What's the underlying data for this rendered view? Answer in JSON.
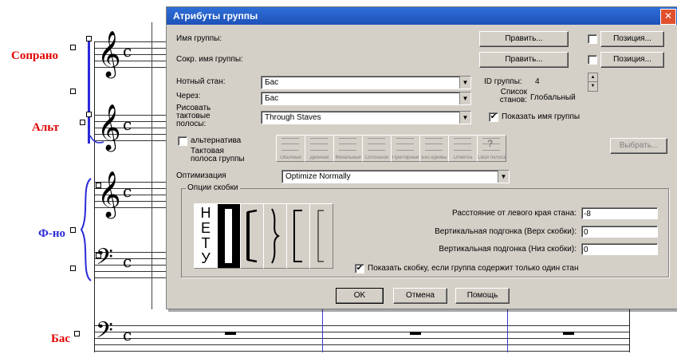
{
  "score": {
    "parts": [
      {
        "name": "Сопрано",
        "color": "#e00000"
      },
      {
        "name": "Альт",
        "color": "#e00000"
      },
      {
        "name": "Ф-но",
        "color": "#2a2ad8"
      },
      {
        "name": "Бас",
        "color": "#e00000"
      }
    ],
    "time_signature": "c"
  },
  "dialog": {
    "title": "Атрибуты группы",
    "group_name_label": "Имя группы:",
    "short_name_label": "Сокр. имя группы:",
    "edit_button": "Править...",
    "edit_button_2": "Править...",
    "position_button": "Позиция...",
    "position_button_2": "Позиция...",
    "staff_label": "Нотный стан:",
    "staff_value": "Бас",
    "through_label": "Через:",
    "through_value": "Бас",
    "draw_barlines_label_1": "Рисовать",
    "draw_barlines_label_2": "тактовые",
    "draw_barlines_label_3": "полосы:",
    "draw_barlines_value": "Through Staves",
    "group_id_label": "ID группы:",
    "group_id_value": "4",
    "staff_list_label_1": "Список",
    "staff_list_label_2": "станов:",
    "staff_list_value": "Глобальный",
    "show_group_name_label": "Показать имя группы",
    "alternative_label": "альтернатива",
    "barline_label_1": "Тактовая",
    "barline_label_2": "полоса группы",
    "barline_tools": [
      "Обычный",
      "Двойная",
      "Финальный",
      "Сплошной",
      "Пунктирный",
      "Без идкивы",
      "Отметка",
      "Своя полоса"
    ],
    "select_button": "Выбрать...",
    "optimize_label": "Оптимизация",
    "optimize_value": "Optimize Normally",
    "bracket_options_title": "Опции скобки",
    "none_letters": [
      "Н",
      "Е",
      "Т",
      "У"
    ],
    "distance_label": "Расстояние от левого края стана:",
    "distance_value": "-8",
    "vert_top_label": "Вертикальная подгонка (Верх скобки):",
    "vert_top_value": "0",
    "vert_bottom_label": "Вертикальная подгонка (Низ скобки):",
    "vert_bottom_value": "0",
    "show_bracket_label": "Показать скобку, если группа содержит только один стан",
    "ok_button": "OK",
    "cancel_button": "Отмена",
    "help_button": "Помощь",
    "check_mark": "✔"
  }
}
